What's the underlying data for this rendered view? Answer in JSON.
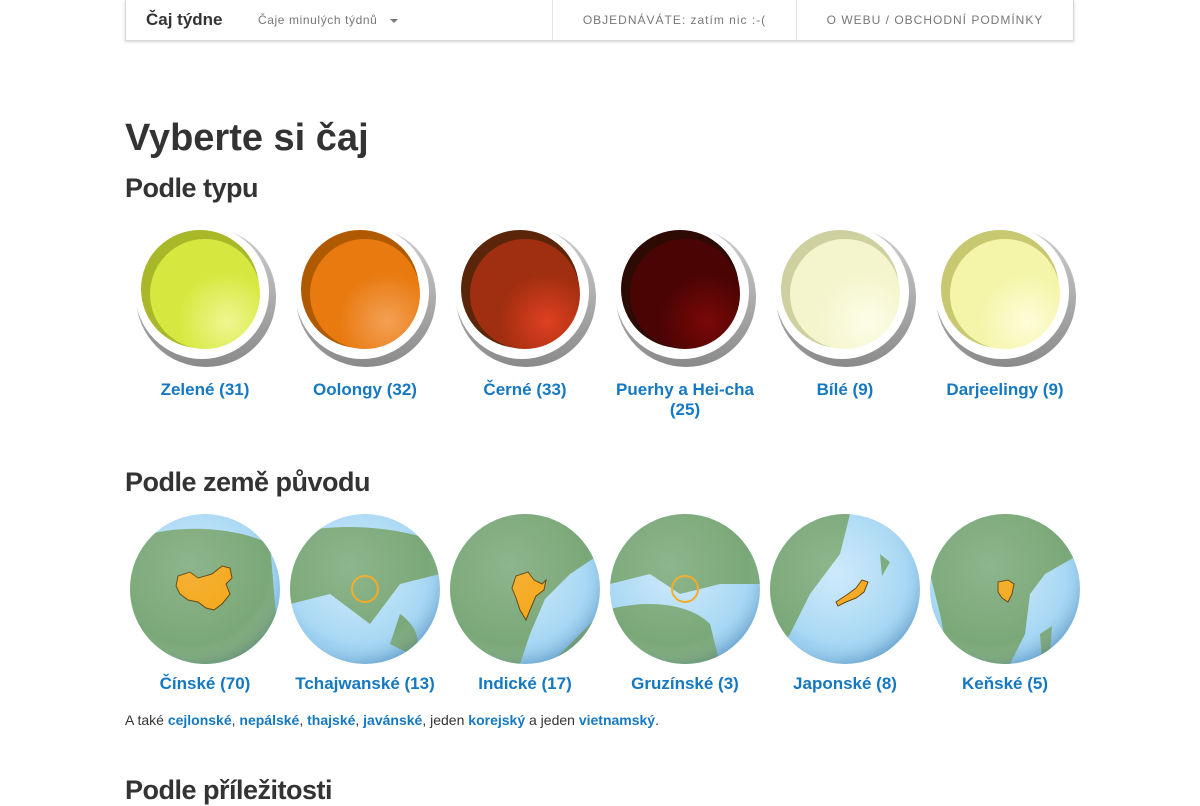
{
  "nav": {
    "brand": "Čaj týdne",
    "dropdown": "Čaje minulých týdnů",
    "order": "OBJEDNÁVÁTE: zatím nic :-(",
    "about": "O WEBU / OBCHODNÍ PODMÍNKY"
  },
  "title": "Vyberte si čaj",
  "by_type": {
    "heading": "Podle typu",
    "items": [
      {
        "label": "Zelené (31)",
        "colors": [
          "#a8b828",
          "#d6e840",
          "#eef790"
        ]
      },
      {
        "label": "Oolongy (32)",
        "colors": [
          "#b05a00",
          "#e87a10",
          "#f4a055"
        ]
      },
      {
        "label": "Černé (33)",
        "colors": [
          "#5a2508",
          "#a02e10",
          "#e04020"
        ]
      },
      {
        "label": "Puerhy a Hei-cha (25)",
        "colors": [
          "#2e0a04",
          "#4a0404",
          "#7a0808"
        ]
      },
      {
        "label": "Bílé (9)",
        "colors": [
          "#cfd0a0",
          "#f4f5cc",
          "#fdfde8"
        ]
      },
      {
        "label": "Darjeelingy (9)",
        "colors": [
          "#c8c870",
          "#f4f5a8",
          "#fdfdd8"
        ]
      }
    ]
  },
  "by_country": {
    "heading": "Podle země původu",
    "items": [
      {
        "label": "Čínské (70)",
        "icon": "china-globe-icon"
      },
      {
        "label": "Tchajwanské (13)",
        "icon": "taiwan-globe-icon"
      },
      {
        "label": "Indické (17)",
        "icon": "india-globe-icon"
      },
      {
        "label": "Gruzínské (3)",
        "icon": "georgia-globe-icon"
      },
      {
        "label": "Japonské (8)",
        "icon": "japan-globe-icon"
      },
      {
        "label": "Keňské (5)",
        "icon": "kenya-globe-icon"
      }
    ],
    "also": {
      "prefix": "A také ",
      "links": [
        "cejlonské",
        "nepálské",
        "thajské",
        "javánské",
        "korejský",
        "vietnamský"
      ],
      "sep1": ", ",
      "sep2": ", ",
      "sep3": ", ",
      "sep4": ", jeden ",
      "sep5": " a jeden ",
      "suffix": "."
    }
  },
  "by_occasion": {
    "heading": "Podle příležitosti"
  },
  "colors": {
    "link": "#1478c2",
    "highlight": "#f4a413",
    "land": "#7aa878",
    "ocean": "#a8d8f4"
  }
}
